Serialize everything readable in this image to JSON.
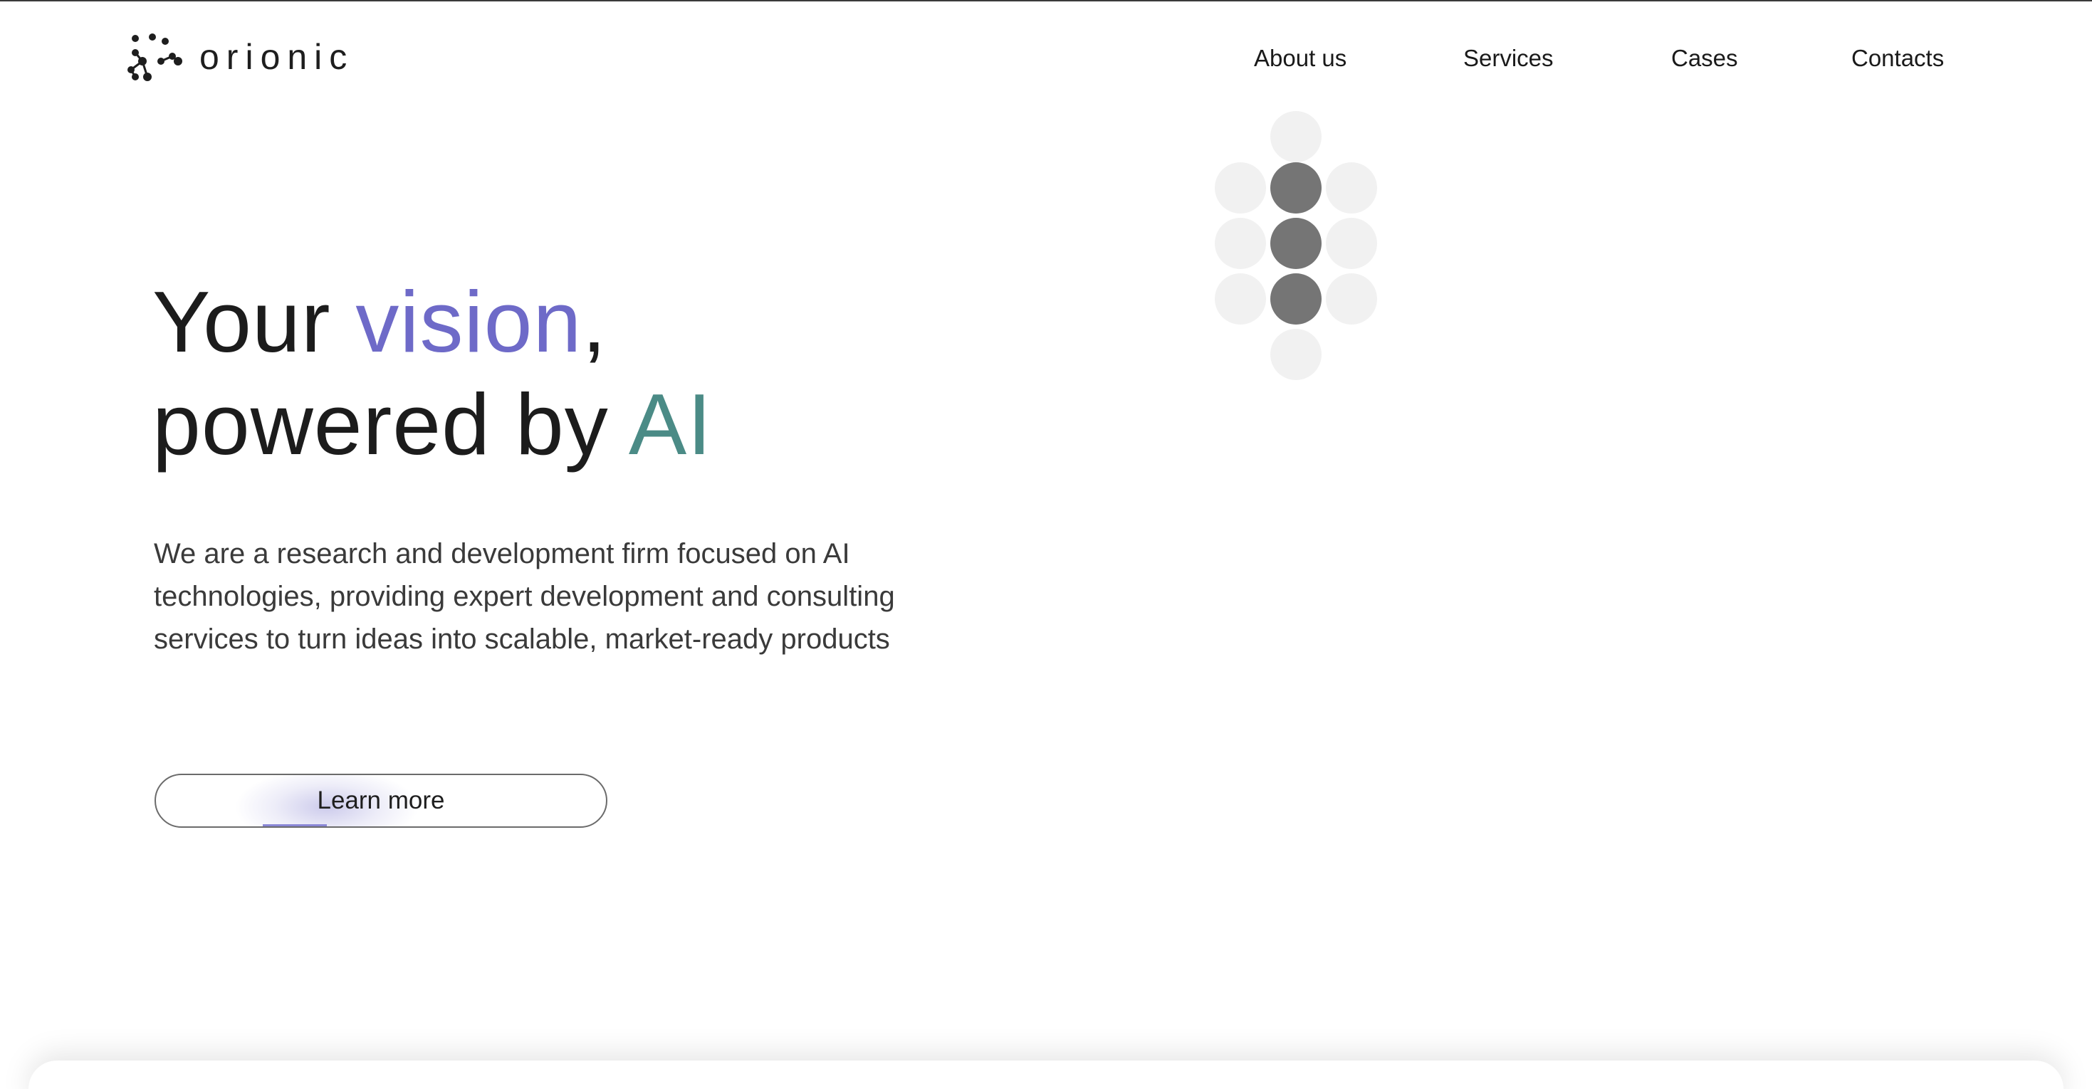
{
  "brand": {
    "name": "orionic",
    "logo_icon": "constellation-icon"
  },
  "nav": {
    "items": [
      {
        "label": "About us"
      },
      {
        "label": "Services"
      },
      {
        "label": "Cases"
      },
      {
        "label": "Contacts"
      }
    ]
  },
  "decoration": {
    "icon": "dot-grid-icon",
    "dark_color": "#757575",
    "light_color": "#f1f1f1"
  },
  "hero": {
    "title_part1": "Your ",
    "title_highlight1": "vision",
    "title_part2": ",",
    "title_line2": "powered by ",
    "title_highlight2": "AI",
    "description": "We are a research and development firm focused on AI technologies, providing expert development and consulting services to turn ideas into scalable, market-ready products",
    "cta_label": "Learn more"
  },
  "colors": {
    "accent_purple": "#6e6ac8",
    "accent_teal": "#4b8b86",
    "text": "#1c1c1c"
  }
}
